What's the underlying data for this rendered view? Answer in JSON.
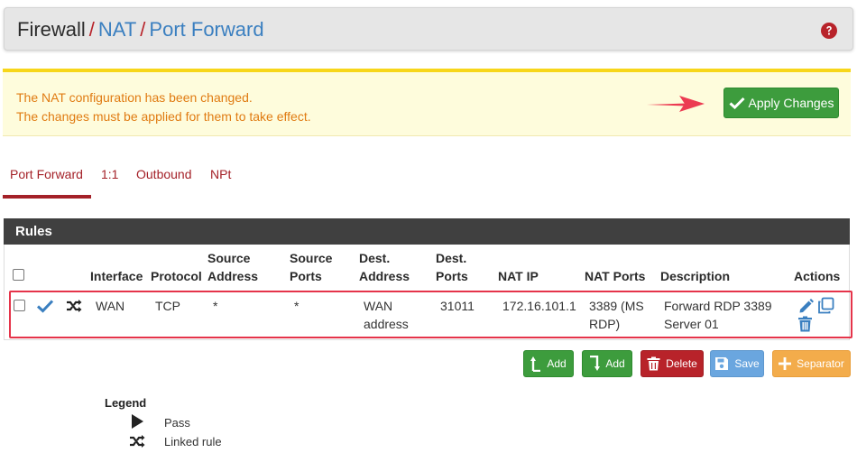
{
  "breadcrumb": {
    "first": "Firewall",
    "second": "NAT",
    "third": "Port Forward",
    "separator": "/"
  },
  "alert": {
    "line1": "The NAT configuration has been changed.",
    "line2": "The changes must be applied for them to take effect.",
    "apply_label": "Apply Changes"
  },
  "tabs": [
    {
      "label": "Port Forward",
      "active": true
    },
    {
      "label": "1:1",
      "active": false
    },
    {
      "label": "Outbound",
      "active": false
    },
    {
      "label": "NPt",
      "active": false
    }
  ],
  "panel": {
    "title": "Rules"
  },
  "columns": {
    "interface": "Interface",
    "protocol": "Protocol",
    "source_address": [
      "Source",
      "Address"
    ],
    "source_ports": [
      "Source",
      "Ports"
    ],
    "dest_address": [
      "Dest.",
      "Address"
    ],
    "dest_ports": [
      "Dest.",
      "Ports"
    ],
    "nat_ip": "NAT IP",
    "nat_ports": "NAT Ports",
    "description": "Description",
    "actions": "Actions"
  },
  "rules": [
    {
      "interface": "WAN",
      "protocol": "TCP",
      "source_address": "*",
      "source_ports": "*",
      "dest_address": [
        "WAN",
        "address"
      ],
      "dest_ports": "31011",
      "nat_ip": "172.16.101.1",
      "nat_ports": [
        "3389 (MS",
        "RDP)"
      ],
      "description": [
        "Forward RDP 3389",
        "Server 01"
      ]
    }
  ],
  "buttons": {
    "add_top": "Add",
    "add_bottom": "Add",
    "delete": "Delete",
    "save": "Save",
    "separator": "Separator"
  },
  "legend": {
    "title": "Legend",
    "pass": "Pass",
    "linked": "Linked rule"
  },
  "colors": {
    "brand_red": "#a42128",
    "link_blue": "#3a7fc0",
    "success_green": "#3d9c3d",
    "alert_orange": "#e07b12",
    "highlight_red": "#e5344a"
  }
}
